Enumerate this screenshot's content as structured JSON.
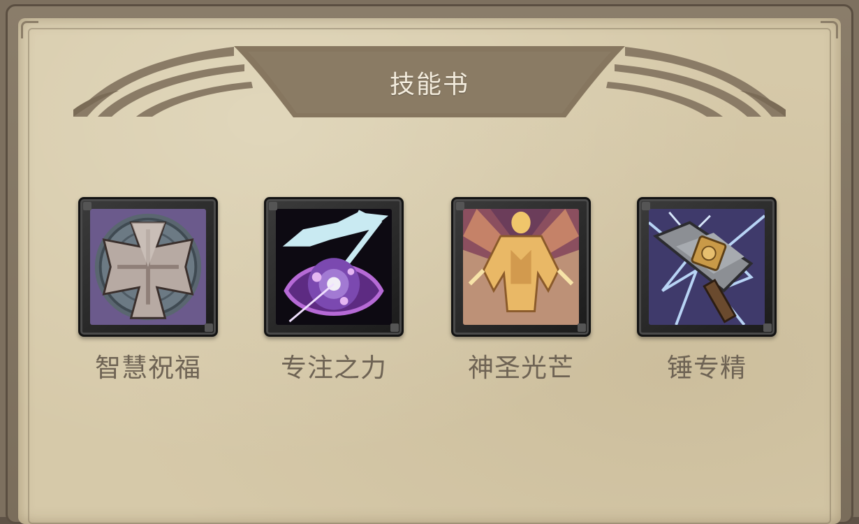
{
  "window": {
    "title": "技能书"
  },
  "skills": [
    {
      "name": "智慧祝福",
      "icon": "iron-cross-shield-icon"
    },
    {
      "name": "专注之力",
      "icon": "arcane-focus-orb-icon"
    },
    {
      "name": "神圣光芒",
      "icon": "holy-radiance-figure-icon"
    },
    {
      "name": "锤专精",
      "icon": "warhammer-mastery-icon"
    }
  ],
  "colors": {
    "parchment": "#d6c9a9",
    "frame": "#7d705f",
    "banner": "#8a7a66",
    "title_text": "#f3ecdd",
    "skill_label": "#6e6354"
  }
}
